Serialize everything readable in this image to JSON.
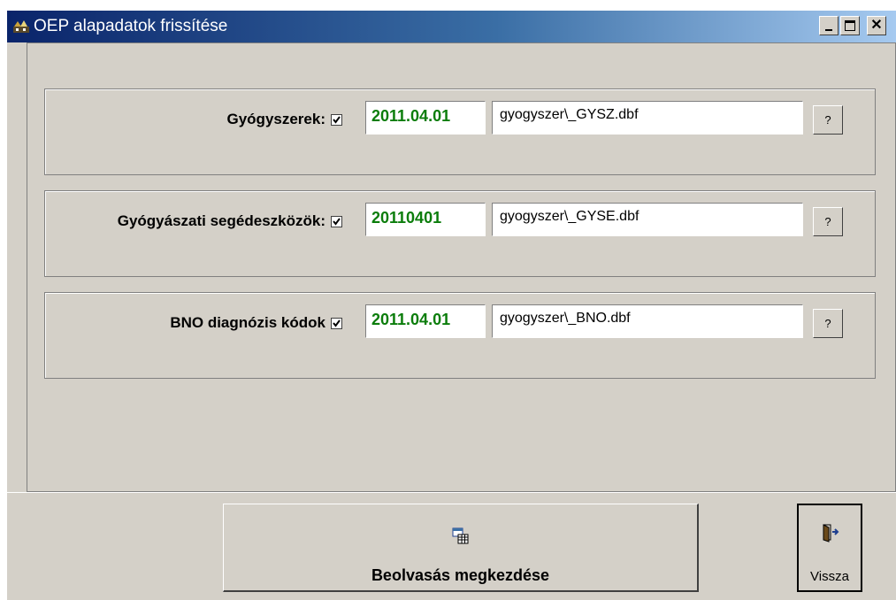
{
  "window": {
    "title": "OEP alapadatok frissítése",
    "icon": "oep-app-icon"
  },
  "rows": [
    {
      "label": "Gyógyszerek:",
      "checked": true,
      "date": "2011.04.01",
      "file": "gyogyszer\\_GYSZ.dbf",
      "help_label": "?"
    },
    {
      "label": "Gyógyászati segédeszközök:",
      "checked": true,
      "date": "20110401",
      "file": "gyogyszer\\_GYSE.dbf",
      "help_label": "?"
    },
    {
      "label": "BNO diagnózis kódok",
      "checked": true,
      "date": "2011.04.01",
      "file": "gyogyszer\\_BNO.dbf",
      "help_label": "?"
    }
  ],
  "actions": {
    "start_label": "Beolvasás megkezdése",
    "start_icon": "import-table-icon",
    "back_label": "Vissza",
    "back_icon": "exit-door-icon"
  },
  "colors": {
    "date_text": "#0b7d0b",
    "titlebar_start": "#0a246a",
    "titlebar_end": "#a6caf0",
    "face": "#d4d0c8"
  }
}
